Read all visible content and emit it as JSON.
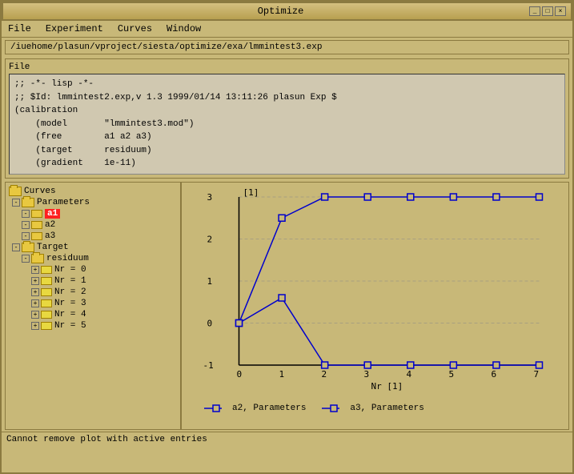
{
  "window": {
    "title": "Optimize",
    "minimize_label": "_",
    "maximize_label": "□",
    "close_label": "×"
  },
  "menubar": {
    "items": [
      "File",
      "Experiment",
      "Curves",
      "Window"
    ]
  },
  "path": {
    "value": "/iuehome/plasun/vproject/siesta/optimize/exa/lmmintest3.exp"
  },
  "file_section": {
    "label": "File",
    "code_lines": [
      ";; -*- lisp -*-",
      ";; $Id: lmmintest2.exp,v 1.3 1999/01/14 13:11:26 plasun Exp $",
      "(calibration",
      "    (model       \"lmmintest3.mod\")",
      "    (free        a1 a2 a3)",
      "    (target      residuum)",
      "    (gradient    1e-11)"
    ]
  },
  "tree": {
    "root_label": "Curves",
    "items": [
      {
        "id": "curves",
        "label": "Curves",
        "indent": 0,
        "type": "root",
        "expanded": true
      },
      {
        "id": "parameters",
        "label": "Parameters",
        "indent": 1,
        "type": "branch",
        "expanded": true
      },
      {
        "id": "a1",
        "label": "a1",
        "indent": 2,
        "type": "leaf",
        "highlighted": true,
        "expanded": true
      },
      {
        "id": "a2",
        "label": "a2",
        "indent": 2,
        "type": "leaf",
        "highlighted": false,
        "expanded": true
      },
      {
        "id": "a3",
        "label": "a3",
        "indent": 2,
        "type": "leaf",
        "highlighted": false,
        "expanded": true
      },
      {
        "id": "target",
        "label": "Target",
        "indent": 1,
        "type": "branch",
        "expanded": true
      },
      {
        "id": "residuum",
        "label": "residuum",
        "indent": 2,
        "type": "branch",
        "expanded": true
      },
      {
        "id": "nr0",
        "label": "Nr = 0",
        "indent": 3,
        "type": "leaf",
        "highlighted": false
      },
      {
        "id": "nr1",
        "label": "Nr = 1",
        "indent": 3,
        "type": "leaf",
        "highlighted": false
      },
      {
        "id": "nr2",
        "label": "Nr = 2",
        "indent": 3,
        "type": "leaf",
        "highlighted": false
      },
      {
        "id": "nr3",
        "label": "Nr = 3",
        "indent": 3,
        "type": "leaf",
        "highlighted": false
      },
      {
        "id": "nr4",
        "label": "Nr = 4",
        "indent": 3,
        "type": "leaf",
        "highlighted": false
      },
      {
        "id": "nr5",
        "label": "Nr = 5",
        "indent": 3,
        "type": "leaf",
        "highlighted": false
      }
    ]
  },
  "chart": {
    "y_axis_label": "[1]",
    "x_axis_label": "Nr [1]",
    "y_ticks": [
      "3",
      "2",
      "1",
      "0",
      "-1"
    ],
    "x_ticks": [
      "0",
      "1",
      "2",
      "3",
      "4",
      "5",
      "6",
      "7"
    ],
    "series": [
      {
        "id": "a2",
        "label": "a2, Parameters",
        "color": "#0000cc",
        "points": [
          {
            "x": 0,
            "y": 0
          },
          {
            "x": 1,
            "y": 2.5
          },
          {
            "x": 2,
            "y": 3.0
          },
          {
            "x": 3,
            "y": 3.0
          },
          {
            "x": 4,
            "y": 3.0
          },
          {
            "x": 5,
            "y": 3.0
          },
          {
            "x": 6,
            "y": 3.0
          },
          {
            "x": 7,
            "y": 3.0
          }
        ]
      },
      {
        "id": "a3",
        "label": "a3, Parameters",
        "color": "#0000cc",
        "points": [
          {
            "x": 0,
            "y": 0
          },
          {
            "x": 1,
            "y": 0.6
          },
          {
            "x": 2,
            "y": -1.0
          },
          {
            "x": 3,
            "y": -1.0
          },
          {
            "x": 4,
            "y": -1.0
          },
          {
            "x": 5,
            "y": -1.0
          },
          {
            "x": 6,
            "y": -1.0
          },
          {
            "x": 7,
            "y": -1.0
          }
        ]
      }
    ]
  },
  "legend": {
    "items": [
      {
        "label": "a2, Parameters"
      },
      {
        "label": "a3, Parameters"
      }
    ]
  },
  "status": {
    "message": "Cannot remove plot with active entries"
  }
}
